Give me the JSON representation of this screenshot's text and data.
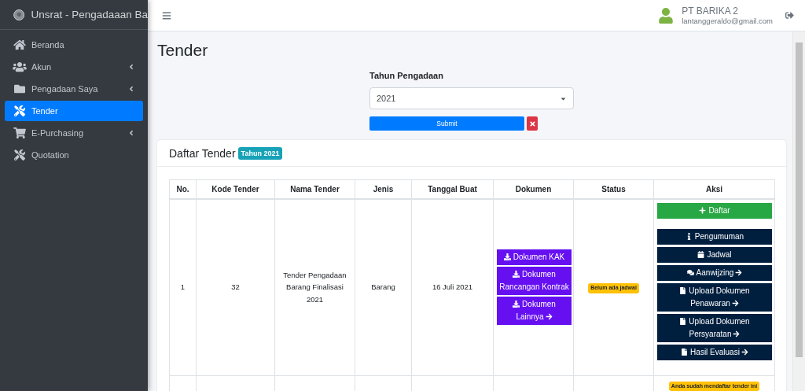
{
  "brand": {
    "title": "Unsrat - Pengadaaan Ba"
  },
  "sidebar": {
    "items": [
      {
        "label": "Beranda",
        "has_submenu": false,
        "selected": false
      },
      {
        "label": "Akun",
        "has_submenu": true,
        "selected": false
      },
      {
        "label": "Pengadaan Saya",
        "has_submenu": true,
        "selected": false
      },
      {
        "label": "Tender",
        "has_submenu": false,
        "selected": true
      },
      {
        "label": "E-Purchasing",
        "has_submenu": true,
        "selected": false
      },
      {
        "label": "Quotation",
        "has_submenu": false,
        "selected": false
      }
    ]
  },
  "user": {
    "name": "PT BARIKA 2",
    "email": "lantanggeraldo@gmail.com"
  },
  "page_title": "Tender",
  "filter": {
    "label": "Tahun Pengadaan",
    "value": "2021",
    "submit": "Submit"
  },
  "card": {
    "title": "Daftar Tender",
    "badge": "Tahun 2021"
  },
  "table": {
    "columns": [
      "No.",
      "Kode Tender",
      "Nama Tender",
      "Jenis",
      "Tanggal Buat",
      "Dokumen",
      "Status",
      "Aksi"
    ],
    "rows": [
      {
        "no": "1",
        "kode": "32",
        "nama": "Tender Pengadaan Barang Finalisasi 2021",
        "jenis": "Barang",
        "tanggal": "16 Juli 2021",
        "documents": [
          {
            "label": "Dokumen KAK",
            "arrow": false
          },
          {
            "label": "Dokumen Rancangan Kontrak",
            "arrow": false
          },
          {
            "label": "Dokumen Lainnya",
            "arrow": true
          }
        ],
        "status": "Belum ada jadwal",
        "actions": [
          {
            "kind": "register",
            "label": "Daftar",
            "arrow": false
          },
          {
            "kind": "announcement",
            "label": "Pengumuman",
            "arrow": false
          },
          {
            "kind": "schedule",
            "label": "Jadwal",
            "arrow": false
          },
          {
            "kind": "discussion",
            "label": "Aanwijzing",
            "arrow": true
          },
          {
            "kind": "document",
            "label": "Upload Dokumen Penawaran",
            "arrow": true
          },
          {
            "kind": "document",
            "label": "Upload Dokumen Persyaratan",
            "arrow": true
          },
          {
            "kind": "document",
            "label": "Hasil Evaluasi",
            "arrow": true
          }
        ]
      },
      {
        "actions": [
          {
            "kind": "notice",
            "label": "Anda sudah mendaftar tender ini"
          }
        ]
      }
    ]
  }
}
